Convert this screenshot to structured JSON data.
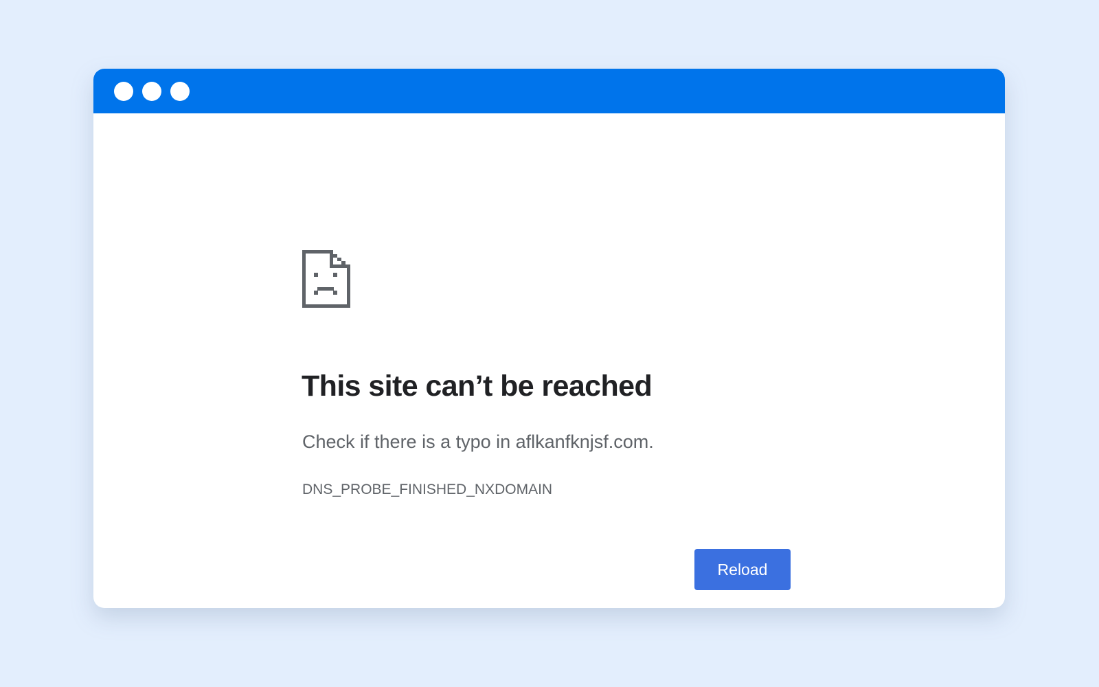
{
  "colors": {
    "page_background": "#e3eefd",
    "window_background": "#ffffff",
    "titlebar": "#0074eb",
    "window_dots": "#ffffff",
    "icon": "#5f6368",
    "heading": "#202124",
    "body_text": "#5f6368",
    "button_background": "#3b70e0",
    "button_text": "#ffffff"
  },
  "window": {
    "dots": [
      "window-dot",
      "window-dot",
      "window-dot"
    ]
  },
  "error": {
    "icon": "sad-page-icon",
    "heading": "This site can’t be reached",
    "message": "Check if there is a typo in aflkanfknjsf.com.",
    "code": "DNS_PROBE_FINISHED_NXDOMAIN",
    "reload_label": "Reload"
  }
}
